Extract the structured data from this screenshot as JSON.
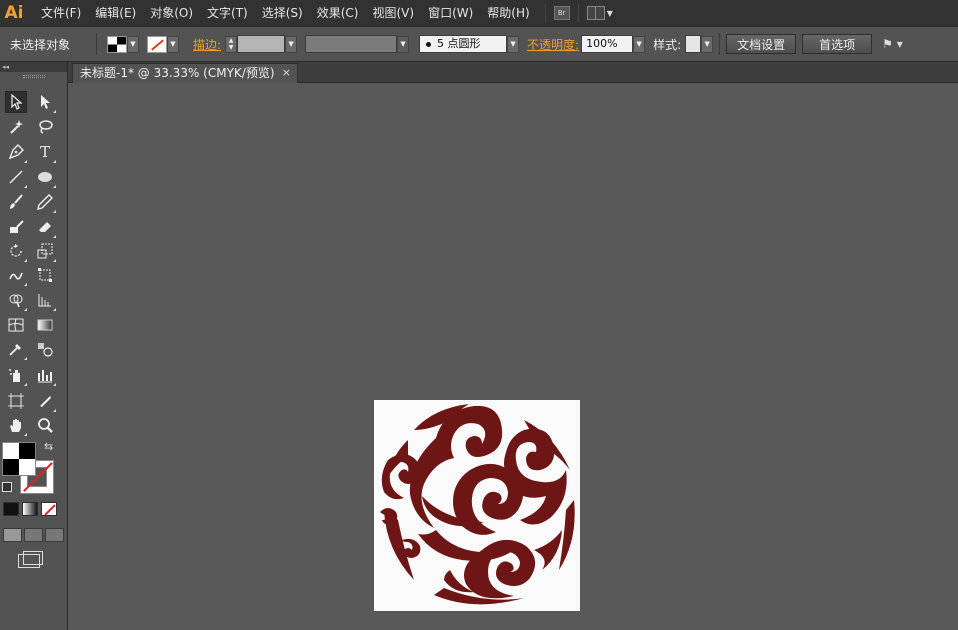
{
  "app": {
    "logo": "Ai",
    "brand_color": "#f0a030"
  },
  "menubar": {
    "items": [
      "文件(F)",
      "编辑(E)",
      "对象(O)",
      "文字(T)",
      "选择(S)",
      "效果(C)",
      "视图(V)",
      "窗口(W)",
      "帮助(H)"
    ],
    "bridge_label": "Br"
  },
  "controlbar": {
    "selection_label": "未选择对象",
    "stroke_label": "描边:",
    "brush_value": "5 点圆形",
    "opacity_label": "不透明度:",
    "opacity_value": "100%",
    "style_label": "样式:",
    "doc_setup_button": "文档设置",
    "preferences_button": "首选项"
  },
  "document": {
    "tab_title": "未标题-1* @ 33.33% (CMYK/预览)",
    "close_glyph": "×"
  },
  "tools": {
    "header_glyph": "◂◂",
    "items": [
      "selection",
      "direct-selection",
      "magic-wand",
      "lasso",
      "pen",
      "type",
      "line-segment",
      "ellipse",
      "paintbrush",
      "pencil",
      "blob-brush",
      "eraser",
      "rotate",
      "scale",
      "warp",
      "free-transform",
      "shape-builder",
      "perspective-grid",
      "mesh",
      "gradient",
      "eyedropper",
      "blend",
      "symbol-sprayer",
      "column-graph",
      "artboard",
      "slice",
      "hand",
      "zoom"
    ]
  },
  "artwork": {
    "color": "#6e1616",
    "description_icon": "auspicious-cloud-motif"
  }
}
